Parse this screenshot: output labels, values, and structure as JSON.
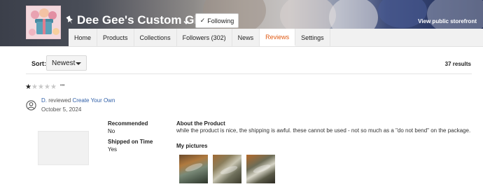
{
  "banner": {
    "shop_name": "Dee Gee's Custom Gifts",
    "following_label": "Following",
    "view_public_label": "View public storefront"
  },
  "nav": {
    "items": [
      {
        "label": "Home",
        "active": false
      },
      {
        "label": "Products",
        "active": false
      },
      {
        "label": "Collections",
        "active": false
      },
      {
        "label": "Followers (302)",
        "active": false
      },
      {
        "label": "News",
        "active": false
      },
      {
        "label": "Reviews",
        "active": true
      },
      {
        "label": "Settings",
        "active": false
      }
    ]
  },
  "sort": {
    "label": "Sort:",
    "selected": "Newest",
    "results": "37 results"
  },
  "review": {
    "rating": 1,
    "max_rating": 5,
    "title": "\"\"",
    "reviewer": "D.",
    "action": "reviewed",
    "product_link": "Create Your Own",
    "date": "October 5, 2024",
    "recommended_label": "Recommended",
    "recommended_value": "No",
    "shipped_label": "Shipped on Time",
    "shipped_value": "Yes",
    "about_label": "About the Product",
    "body": "while the product is nice, the shipping is awful. these cannot be used - not so much as a \"do not bend\" on the package.",
    "pictures_label": "My pictures",
    "picture_count": 3
  },
  "colors": {
    "accent": "#e05a13",
    "link": "#2f5fa8"
  }
}
